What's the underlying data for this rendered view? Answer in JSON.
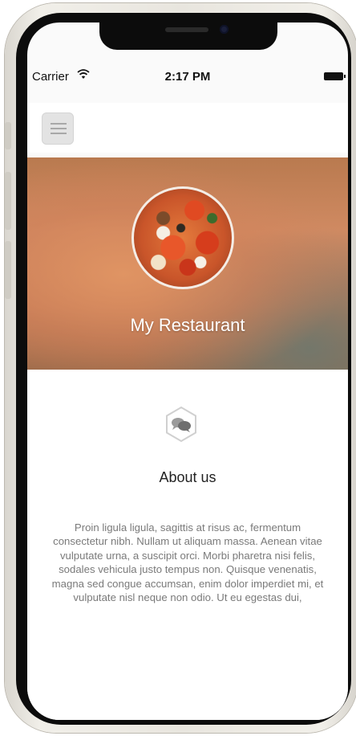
{
  "status_bar": {
    "carrier": "Carrier",
    "time": "2:17 PM"
  },
  "nav": {
    "menu_icon": "hamburger-icon"
  },
  "hero": {
    "restaurant_name": "My Restaurant",
    "image": "pizza-avatar"
  },
  "about": {
    "icon": "chat-bubbles-icon",
    "title": "About us",
    "body": "Proin ligula ligula, sagittis at risus ac, fermentum consectetur nibh. Nullam ut aliquam massa. Aenean vitae vulputate urna, a suscipit orci. Morbi pharetra nisi felis, sodales vehicula justo tempus non. Quisque venenatis, magna sed congue accumsan, enim dolor imperdiet mi, et vulputate nisl neque non odio. Ut eu egestas dui,"
  },
  "colors": {
    "hero_accent": "#c57e58",
    "text_muted": "#7a7a7a"
  }
}
